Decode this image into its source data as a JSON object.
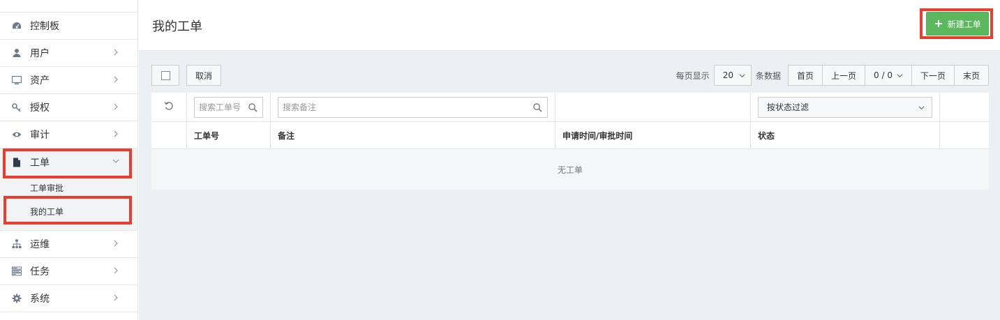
{
  "sidebar": {
    "items": [
      {
        "label": "控制板",
        "icon": "dashboard-icon"
      },
      {
        "label": "用户",
        "icon": "user-icon"
      },
      {
        "label": "资产",
        "icon": "monitor-icon"
      },
      {
        "label": "授权",
        "icon": "key-icon"
      },
      {
        "label": "审计",
        "icon": "eye-icon"
      },
      {
        "label": "工单",
        "icon": "file-icon"
      },
      {
        "label": "运维",
        "icon": "sitemap-icon"
      },
      {
        "label": "任务",
        "icon": "tasks-icon"
      },
      {
        "label": "系统",
        "icon": "gear-icon"
      }
    ],
    "ticket_sub": [
      {
        "label": "工单审批"
      },
      {
        "label": "我的工单"
      }
    ]
  },
  "header": {
    "title": "我的工单",
    "new_button": "新建工单"
  },
  "toolbar": {
    "cancel": "取消",
    "per_page_prefix": "每页显示",
    "per_page_value": "20",
    "per_page_suffix": "条数据",
    "first": "首页",
    "prev": "上一页",
    "page_indicator": "0 / 0",
    "next": "下一页",
    "last": "末页"
  },
  "table": {
    "filters": {
      "ticket_no_placeholder": "搜索工单号",
      "remark_placeholder": "搜索备注",
      "status_filter": "按状态过滤"
    },
    "headers": [
      "工单号",
      "备注",
      "申请时间/审批时间",
      "状态"
    ],
    "empty_text": "无工单"
  },
  "colors": {
    "accent_green": "#5cb85c",
    "highlight_red": "#ea3d2f"
  }
}
